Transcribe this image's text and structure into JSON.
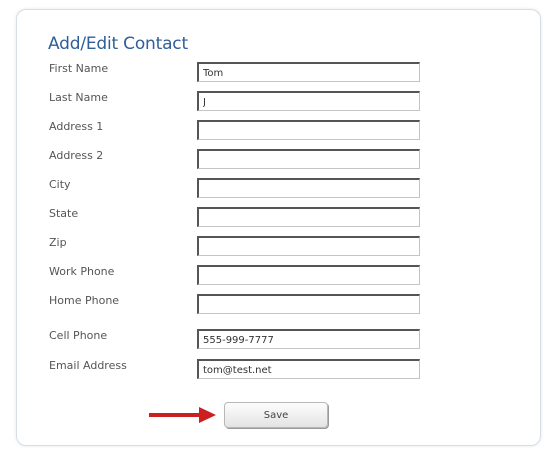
{
  "form": {
    "title": "Add/Edit Contact",
    "fields": [
      {
        "label": "First Name",
        "value": "Tom"
      },
      {
        "label": "Last Name",
        "value": "J"
      },
      {
        "label": "Address 1",
        "value": ""
      },
      {
        "label": "Address 2",
        "value": ""
      },
      {
        "label": "City",
        "value": ""
      },
      {
        "label": "State",
        "value": ""
      },
      {
        "label": "Zip",
        "value": ""
      },
      {
        "label": "Work Phone",
        "value": ""
      },
      {
        "label": "Home Phone",
        "value": ""
      },
      {
        "label": "Cell Phone",
        "value": "555-999-7777"
      },
      {
        "label": "Email Address",
        "value": "tom@test.net"
      }
    ],
    "save_label": "Save"
  },
  "colors": {
    "title": "#2f5e9a",
    "arrow": "#cc1f1f"
  },
  "icons": {
    "pointer": "right-arrow-icon"
  }
}
